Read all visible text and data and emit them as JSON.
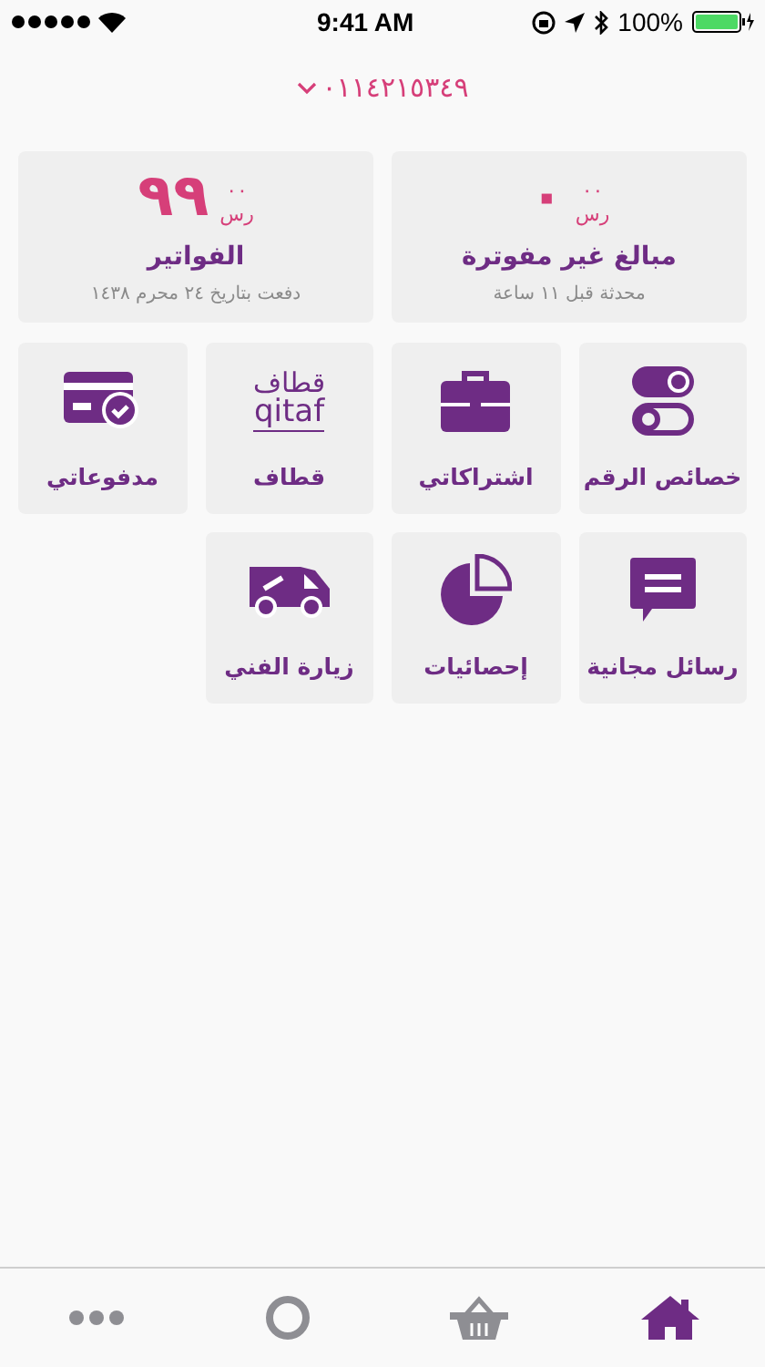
{
  "status_bar": {
    "time": "9:41 AM",
    "battery": "100%"
  },
  "account": {
    "number": "٠١١٤٢١٥٣٤٩"
  },
  "summary_cards": [
    {
      "amount": "٠",
      "decimals": "٠٠",
      "currency": "رس",
      "title": "مبالغ غير مفوترة",
      "subtitle": "محدثة قبل ١١ ساعة"
    },
    {
      "amount": "٩٩",
      "decimals": "٠٠",
      "currency": "رس",
      "title": "الفواتير",
      "subtitle": "دفعت بتاريخ ٢٤ محرم ١٤٣٨"
    }
  ],
  "tiles": [
    {
      "kind": "toggles",
      "label": "خصائص الرقم"
    },
    {
      "kind": "briefcase",
      "label": "اشتراكاتي"
    },
    {
      "kind": "logo",
      "label": "قطاف",
      "logo": [
        "قطاف",
        "qitaf"
      ]
    },
    {
      "kind": "card",
      "label": "مدفوعاتي"
    },
    {
      "kind": "chat",
      "label": "رسائل مجانية"
    },
    {
      "kind": "pie",
      "label": "إحصائيات"
    },
    {
      "kind": "van",
      "label": "زيارة الفني"
    }
  ],
  "tab_bar": [
    {
      "kind": "home",
      "selected": true
    },
    {
      "kind": "basket",
      "selected": false
    },
    {
      "kind": "circle",
      "selected": false
    },
    {
      "kind": "more",
      "selected": false
    }
  ]
}
